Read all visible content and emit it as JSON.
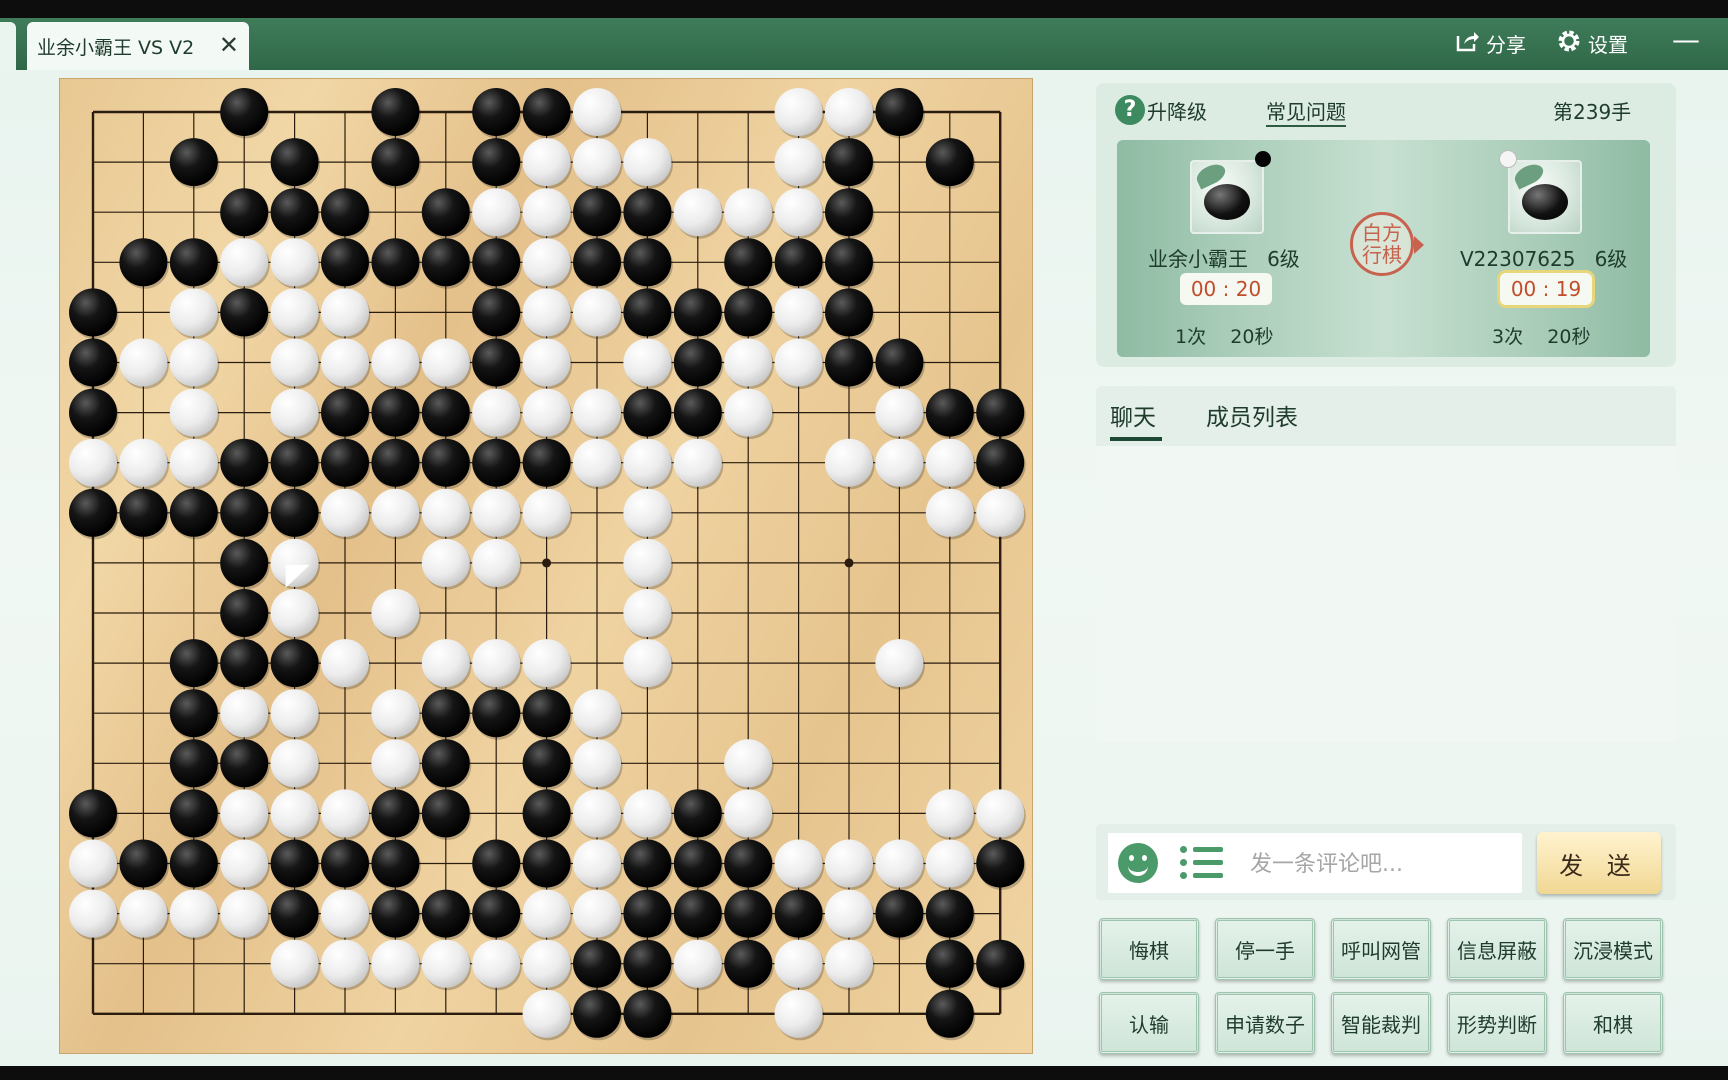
{
  "window": {
    "tab_title": "业余小霸王 VS V2",
    "close_symbol": "✕",
    "share_label": "分享",
    "settings_label": "设置",
    "minimize_symbol": "—",
    "icons": {
      "share": "share-icon",
      "settings": "gear-icon",
      "help": "help-icon",
      "emoji": "emoji-icon",
      "list": "list-icon"
    }
  },
  "info": {
    "help_symbol": "?",
    "upgrade_label": "升降级",
    "faq_label": "常见问题",
    "move_number": "第239手",
    "turn_seal": "白方\n行棋"
  },
  "players": [
    {
      "name": "业余小霸王",
      "rank": "6级",
      "time": "00 : 20",
      "byoyomi_count": "1次",
      "byoyomi_seconds": "20秒",
      "stone_color": "black",
      "active": false
    },
    {
      "name": "V22307625",
      "rank": "6级",
      "time": "00 : 19",
      "byoyomi_count": "3次",
      "byoyomi_seconds": "20秒",
      "stone_color": "white",
      "active": true
    }
  ],
  "chat": {
    "tabs": [
      "聊天",
      "成员列表"
    ],
    "active_tab": "聊天",
    "placeholder": "发一条评论吧...",
    "send_label": "发 送"
  },
  "actions": {
    "row1": [
      "悔棋",
      "停一手",
      "呼叫网管",
      "信息屏蔽",
      "沉浸模式"
    ],
    "row2": [
      "认输",
      "申请数子",
      "智能裁判",
      "形势判断",
      "和棋"
    ]
  },
  "board": {
    "size": 19,
    "last_move": [
      9,
      4
    ],
    "star_points": [
      [
        3,
        3
      ],
      [
        3,
        9
      ],
      [
        3,
        15
      ],
      [
        9,
        3
      ],
      [
        9,
        9
      ],
      [
        9,
        15
      ],
      [
        15,
        3
      ],
      [
        15,
        9
      ],
      [
        15,
        15
      ]
    ],
    "colors": {
      "line": "#2a1c0e",
      "board": "#ecd09c",
      "black_stone": "#0b0b0b",
      "white_stone": "#f4f4f4"
    },
    "rows": [
      "...B..B.BBW...WWB..",
      "..B.B.B.BWWW..WB.B.",
      "...BBB.BWWBBWWWB...",
      ".BBWWBBBBWBB.BBB...",
      "B.WBWW..BWWBBBWB...",
      "BWW.WWWWBW.WBWWBB..",
      "B.W.WBBBWWWBBW..WBBB",
      "WWWBBBBBBBWWW..WWWB",
      "BBBBBWWWWW.W.....WW",
      "...BW..WW..W.......",
      "...BW.W....W.......",
      "..BBBW.WWW.W....W..",
      "..BWW.WBBBW........",
      "..BBW.WB.BW..W.....",
      "B.BWWWBB.BWWBW...WW",
      "WBBWBBB.BBWBBBWWWWB",
      "WWWWBWBBBWWBBBBWBB.",
      "....WWWWWWBBWBWW.BB",
      ".........WBB..W..B."
    ]
  }
}
